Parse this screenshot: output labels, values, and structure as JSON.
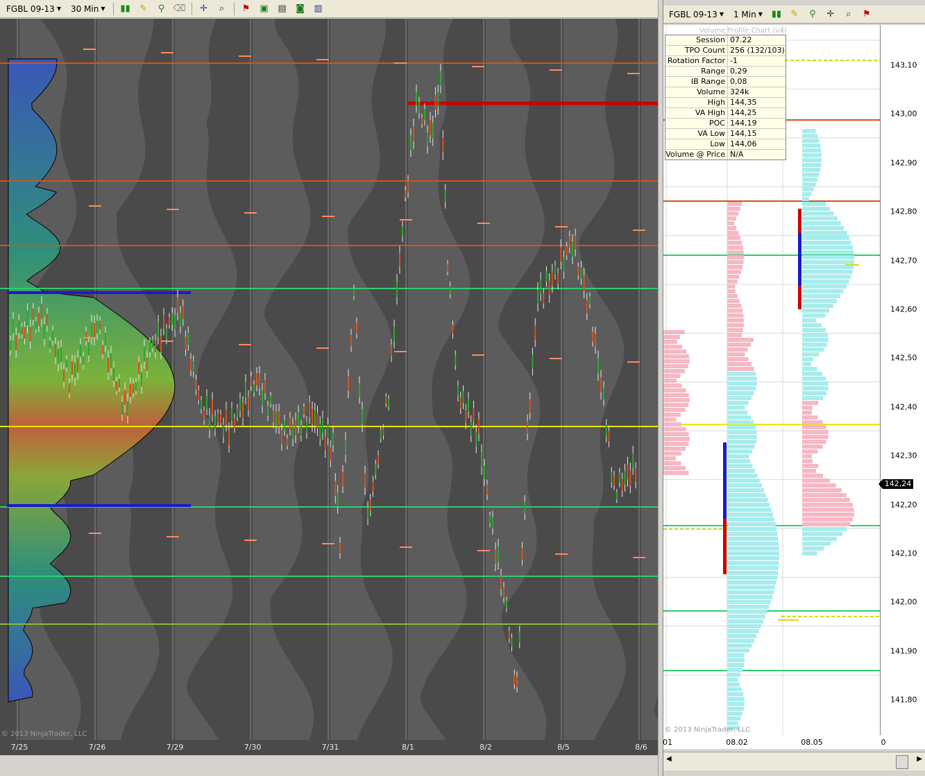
{
  "left_toolbar": {
    "instrument": "FGBL 09-13",
    "interval": "30 Min"
  },
  "right_toolbar": {
    "instrument": "FGBL 09-13",
    "interval": "1 Min"
  },
  "right_panel_title": "Volume Profile Chart (v4)",
  "info_panel": [
    {
      "key": "Session",
      "value": "07.22"
    },
    {
      "key": "TPO Count",
      "value": "256 (132/103)"
    },
    {
      "key": "Rotation Factor",
      "value": "-1"
    },
    {
      "key": "Range",
      "value": "0,29"
    },
    {
      "key": "IB Range",
      "value": "0,08"
    },
    {
      "key": "Volume",
      "value": "324k"
    },
    {
      "key": "High",
      "value": "144,35"
    },
    {
      "key": "VA High",
      "value": "144,25"
    },
    {
      "key": "POC",
      "value": "144,19"
    },
    {
      "key": "VA Low",
      "value": "144,15"
    },
    {
      "key": "Low",
      "value": "144,06"
    },
    {
      "key": "Volume @ Price",
      "value": "N/A"
    }
  ],
  "price_axis": [
    "143,10",
    "143,00",
    "142,90",
    "142,80",
    "142,70",
    "142,60",
    "142,50",
    "142,40",
    "142,30",
    "142,20",
    "142,10",
    "142,00",
    "141,90",
    "141,80"
  ],
  "current_price": "142,24",
  "left_dates": [
    "7/25",
    "7/26",
    "7/29",
    "7/30",
    "7/31",
    "8/1",
    "8/2",
    "8/5",
    "8/6"
  ],
  "right_dates": [
    "01",
    "08.02",
    "08.05",
    "0"
  ],
  "copyright_left": "© 2013 NinjaTrader, LLC",
  "copyright_right": "© 2013 NinjaTrader, LLC",
  "colors": {
    "chart_bg": "#4a4a4a",
    "profile_bg": "#5c5c5c",
    "green_line": "#2ecc71",
    "orange_line": "#d2541e",
    "yellow_line": "#e8e800",
    "blue_bar": "#1a1acc",
    "red_bar": "#cc0000"
  }
}
